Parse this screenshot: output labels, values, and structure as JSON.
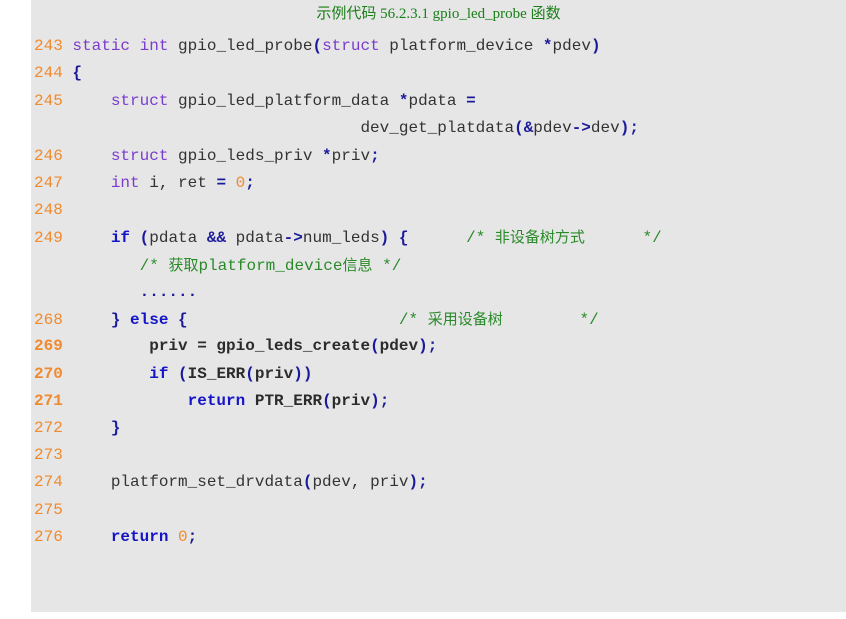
{
  "title": "示例代码 56.2.3.1 gpio_led_probe 函数",
  "colors": {
    "background": "#e6e6e6",
    "line_number": "#f08a2e",
    "keyword_type": "#7a3ccf",
    "keyword_control": "#1515c8",
    "comment": "#2a8a2a",
    "title": "#1a7f1a"
  },
  "lines": [
    {
      "num": "243",
      "tokens": [
        [
          "kw",
          "static"
        ],
        [
          "t",
          " "
        ],
        [
          "kw",
          "int"
        ],
        [
          "t",
          " gpio_led_probe"
        ],
        [
          "pn",
          "("
        ],
        [
          "kw",
          "struct"
        ],
        [
          "t",
          " platform_device "
        ],
        [
          "pn",
          "*"
        ],
        [
          "t",
          "pdev"
        ],
        [
          "pn",
          ")"
        ]
      ]
    },
    {
      "num": "244",
      "tokens": [
        [
          "pn",
          "{"
        ]
      ]
    },
    {
      "num": "245",
      "tokens": [
        [
          "t",
          "    "
        ],
        [
          "kw",
          "struct"
        ],
        [
          "t",
          " gpio_led_platform_data "
        ],
        [
          "pn",
          "*"
        ],
        [
          "t",
          "pdata "
        ],
        [
          "pn",
          "="
        ]
      ]
    },
    {
      "num": "",
      "tokens": [
        [
          "t",
          "                              dev_get_platdata"
        ],
        [
          "pn",
          "("
        ],
        [
          "pn",
          "&"
        ],
        [
          "t",
          "pdev"
        ],
        [
          "pn",
          "->"
        ],
        [
          "t",
          "dev"
        ],
        [
          "pn",
          ")"
        ],
        [
          "pn",
          ";"
        ]
      ]
    },
    {
      "num": "246",
      "tokens": [
        [
          "t",
          "    "
        ],
        [
          "kw",
          "struct"
        ],
        [
          "t",
          " gpio_leds_priv "
        ],
        [
          "pn",
          "*"
        ],
        [
          "t",
          "priv"
        ],
        [
          "pn",
          ";"
        ]
      ]
    },
    {
      "num": "247",
      "tokens": [
        [
          "t",
          "    "
        ],
        [
          "kw",
          "int"
        ],
        [
          "t",
          " i, ret "
        ],
        [
          "pn",
          "="
        ],
        [
          "t",
          " "
        ],
        [
          "num",
          "0"
        ],
        [
          "pn",
          ";"
        ]
      ]
    },
    {
      "num": "248",
      "tokens": []
    },
    {
      "num": "249",
      "tokens": [
        [
          "t",
          "    "
        ],
        [
          "kb",
          "if"
        ],
        [
          "t",
          " "
        ],
        [
          "pn",
          "("
        ],
        [
          "t",
          "pdata "
        ],
        [
          "pn",
          "&&"
        ],
        [
          "t",
          " pdata"
        ],
        [
          "pn",
          "->"
        ],
        [
          "t",
          "num_leds"
        ],
        [
          "pn",
          ")"
        ],
        [
          "t",
          " "
        ],
        [
          "pn",
          "{"
        ],
        [
          "t",
          "      "
        ],
        [
          "cm",
          "/* "
        ],
        [
          "cmcjk",
          "非设备树方式"
        ],
        [
          "cm",
          "      */"
        ]
      ]
    },
    {
      "num": "",
      "tokens": [
        [
          "t",
          "       "
        ],
        [
          "cm",
          "/* "
        ],
        [
          "cmcjk",
          "获取"
        ],
        [
          "cm",
          "platform_device"
        ],
        [
          "cmcjk",
          "信息"
        ],
        [
          "cm",
          " */"
        ]
      ]
    },
    {
      "num": "",
      "tokens": [
        [
          "t",
          "       "
        ],
        [
          "pn",
          "......"
        ]
      ]
    },
    {
      "num": "268",
      "tokens": [
        [
          "t",
          "    "
        ],
        [
          "pn",
          "}"
        ],
        [
          "t",
          " "
        ],
        [
          "kb",
          "else"
        ],
        [
          "t",
          " "
        ],
        [
          "pn",
          "{"
        ],
        [
          "t",
          "                      "
        ],
        [
          "cm",
          "/* "
        ],
        [
          "cmcjk",
          "采用设备树"
        ],
        [
          "cm",
          "        */"
        ]
      ]
    },
    {
      "num": "269",
      "bold": true,
      "tokens": [
        [
          "t",
          "        "
        ],
        [
          "hl",
          "priv = gpio_leds_create"
        ],
        [
          "pn",
          "("
        ],
        [
          "hl",
          "pdev"
        ],
        [
          "pn",
          ")"
        ],
        [
          "pn",
          ";"
        ]
      ]
    },
    {
      "num": "270",
      "bold": true,
      "tokens": [
        [
          "t",
          "        "
        ],
        [
          "kb",
          "if"
        ],
        [
          "t",
          " "
        ],
        [
          "pn",
          "("
        ],
        [
          "hl",
          "IS_ERR"
        ],
        [
          "pn",
          "("
        ],
        [
          "hl",
          "priv"
        ],
        [
          "pn",
          "))"
        ]
      ]
    },
    {
      "num": "271",
      "bold": true,
      "tokens": [
        [
          "t",
          "            "
        ],
        [
          "kb",
          "return"
        ],
        [
          "t",
          " "
        ],
        [
          "hl",
          "PTR_ERR"
        ],
        [
          "pn",
          "("
        ],
        [
          "hl",
          "priv"
        ],
        [
          "pn",
          ")"
        ],
        [
          "pn",
          ";"
        ]
      ]
    },
    {
      "num": "272",
      "tokens": [
        [
          "t",
          "    "
        ],
        [
          "pn",
          "}"
        ]
      ]
    },
    {
      "num": "273",
      "tokens": []
    },
    {
      "num": "274",
      "tokens": [
        [
          "t",
          "    platform_set_drvdata"
        ],
        [
          "pn",
          "("
        ],
        [
          "t",
          "pdev, priv"
        ],
        [
          "pn",
          ")"
        ],
        [
          "pn",
          ";"
        ]
      ]
    },
    {
      "num": "275",
      "tokens": []
    },
    {
      "num": "276",
      "tokens": [
        [
          "t",
          "    "
        ],
        [
          "kb",
          "return"
        ],
        [
          "t",
          " "
        ],
        [
          "num",
          "0"
        ],
        [
          "pn",
          ";"
        ]
      ]
    }
  ]
}
